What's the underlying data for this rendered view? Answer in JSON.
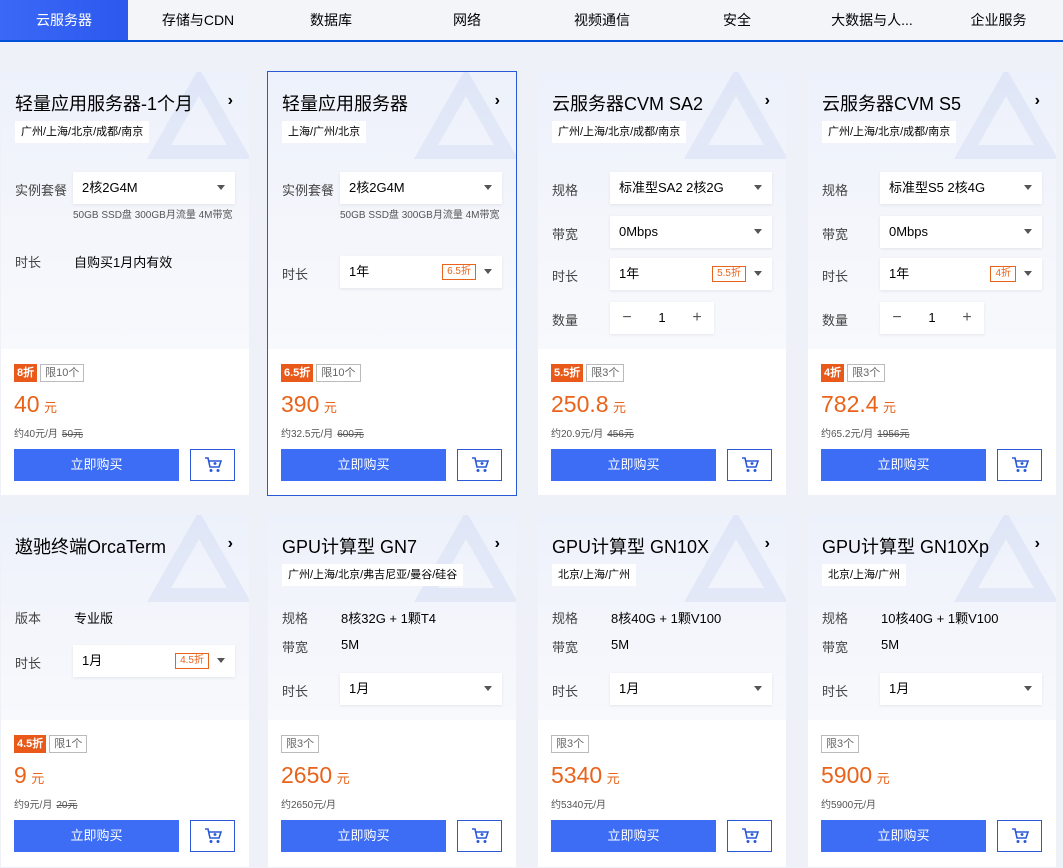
{
  "tabs": [
    {
      "label": "云服务器",
      "active": true
    },
    {
      "label": "存储与CDN"
    },
    {
      "label": "数据库"
    },
    {
      "label": "网络"
    },
    {
      "label": "视频通信"
    },
    {
      "label": "安全"
    },
    {
      "label": "大数据与人..."
    },
    {
      "label": "企业服务"
    }
  ],
  "common": {
    "buy_label": "立即购买"
  },
  "cards": [
    {
      "title": "轻量应用服务器-1个月",
      "regions": "广州/上海/北京/成都/南京",
      "rows": [
        {
          "label": "实例套餐",
          "type": "select",
          "value": "2核2G4M",
          "note": "50GB SSD盘 300GB月流量 4M带宽"
        },
        {
          "label": "时长",
          "type": "text",
          "value": "自购买1月内有效"
        }
      ],
      "discount": "8折",
      "limit": "限10个",
      "price": "40",
      "unit": "元",
      "per_month": "约40元/月",
      "original": "50元"
    },
    {
      "title": "轻量应用服务器",
      "regions": "上海/广州/北京",
      "rows": [
        {
          "label": "实例套餐",
          "type": "select",
          "value": "2核2G4M",
          "note": "50GB SSD盘 300GB月流量 4M带宽"
        },
        {
          "label": "时长",
          "type": "select",
          "value": "1年",
          "tag": "6.5折"
        }
      ],
      "discount": "6.5折",
      "limit": "限10个",
      "price": "390",
      "unit": "元",
      "per_month": "约32.5元/月",
      "original": "600元"
    },
    {
      "title": "云服务器CVM SA2",
      "regions": "广州/上海/北京/成都/南京",
      "rows": [
        {
          "label": "规格",
          "type": "select",
          "value": "标准型SA2 2核2G"
        },
        {
          "label": "带宽",
          "type": "select",
          "value": "0Mbps"
        },
        {
          "label": "时长",
          "type": "select",
          "value": "1年",
          "tag": "5.5折"
        },
        {
          "label": "数量",
          "type": "stepper",
          "value": "1"
        }
      ],
      "discount": "5.5折",
      "limit": "限3个",
      "price": "250.8",
      "unit": "元",
      "per_month": "约20.9元/月",
      "original": "456元"
    },
    {
      "title": "云服务器CVM S5",
      "regions": "广州/上海/北京/成都/南京",
      "rows": [
        {
          "label": "规格",
          "type": "select",
          "value": "标准型S5 2核4G"
        },
        {
          "label": "带宽",
          "type": "select",
          "value": "0Mbps"
        },
        {
          "label": "时长",
          "type": "select",
          "value": "1年",
          "tag": "4折"
        },
        {
          "label": "数量",
          "type": "stepper",
          "value": "1"
        }
      ],
      "discount": "4折",
      "limit": "限3个",
      "price": "782.4",
      "unit": "元",
      "per_month": "约65.2元/月",
      "original": "1956元"
    },
    {
      "title": "遨驰终端OrcaTerm",
      "regions": "",
      "rows": [
        {
          "label": "版本",
          "type": "text",
          "value": "专业版"
        },
        {
          "label": "时长",
          "type": "select",
          "value": "1月",
          "tag": "4.5折"
        }
      ],
      "discount": "4.5折",
      "limit": "限1个",
      "price": "9",
      "unit": "元",
      "per_month": "约9元/月",
      "original": "20元"
    },
    {
      "title": "GPU计算型 GN7",
      "regions": "广州/上海/北京/弗吉尼亚/曼谷/硅谷",
      "rows": [
        {
          "label": "规格",
          "type": "text",
          "value": "8核32G + 1颗T4"
        },
        {
          "label": "带宽",
          "type": "text",
          "value": "5M"
        },
        {
          "label": "时长",
          "type": "select",
          "value": "1月"
        }
      ],
      "discount": "",
      "limit": "限3个",
      "price": "2650",
      "unit": "元",
      "per_month": "约2650元/月",
      "original": ""
    },
    {
      "title": "GPU计算型 GN10X",
      "regions": "北京/上海/广州",
      "rows": [
        {
          "label": "规格",
          "type": "text",
          "value": "8核40G + 1颗V100"
        },
        {
          "label": "带宽",
          "type": "text",
          "value": "5M"
        },
        {
          "label": "时长",
          "type": "select",
          "value": "1月"
        }
      ],
      "discount": "",
      "limit": "限3个",
      "price": "5340",
      "unit": "元",
      "per_month": "约5340元/月",
      "original": ""
    },
    {
      "title": "GPU计算型 GN10Xp",
      "regions": "北京/上海/广州",
      "rows": [
        {
          "label": "规格",
          "type": "text",
          "value": "10核40G + 1颗V100"
        },
        {
          "label": "带宽",
          "type": "text",
          "value": "5M"
        },
        {
          "label": "时长",
          "type": "select",
          "value": "1月"
        }
      ],
      "discount": "",
      "limit": "限3个",
      "price": "5900",
      "unit": "元",
      "per_month": "约5900元/月",
      "original": ""
    }
  ],
  "colors": {
    "accent": "#3d6df5",
    "discount": "#e9631a",
    "border_selected": "#2b58d6"
  },
  "icons": {
    "arrow": "chevron-right-icon",
    "cart": "cart-icon",
    "caret": "caret-down-icon"
  }
}
